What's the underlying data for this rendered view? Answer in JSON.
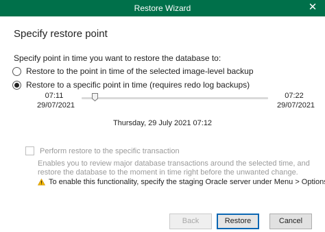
{
  "window": {
    "title": "Restore Wizard",
    "close_glyph": "✕"
  },
  "header": {
    "title": "Specify restore point"
  },
  "prompt": "Specify point in time you want to restore the database to:",
  "options": [
    {
      "label": "Restore to the point in time of the selected image-level backup",
      "checked": false
    },
    {
      "label": "Restore to a specific point in time (requires redo log backups)",
      "checked": true
    }
  ],
  "slider": {
    "start_time": "07:11",
    "start_date": "29/07/2021",
    "end_time": "07:22",
    "end_date": "29/07/2021",
    "selected_label": "Thursday, 29 July 2021 07:12"
  },
  "transaction": {
    "checkbox_label": "Perform restore to the specific transaction",
    "checked": false,
    "enabled": false,
    "description": "Enables you to review major database transactions around the selected time, and restore the database to the moment in time right before the unwanted change.",
    "warning_icon": "warning-icon",
    "warning": "To enable this functionality, specify the staging Oracle server under Menu > Options."
  },
  "buttons": {
    "back": "Back",
    "restore": "Restore",
    "cancel": "Cancel"
  },
  "colors": {
    "titlebar": "#00704a",
    "warning": "#f0b400",
    "primary_border": "#0a66b3"
  }
}
